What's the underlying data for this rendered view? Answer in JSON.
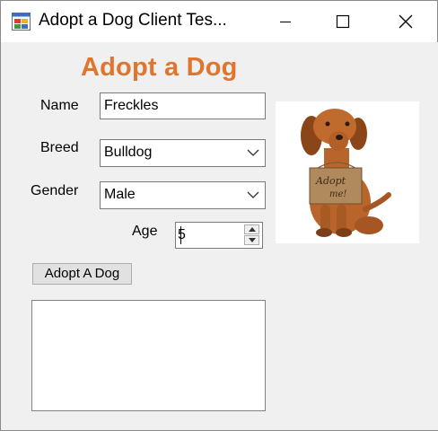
{
  "window": {
    "title": "Adopt a Dog Client Tes..."
  },
  "form": {
    "heading": "Adopt a Dog",
    "name_label": "Name",
    "name_value": "Freckles",
    "breed_label": "Breed",
    "breed_value": "Bulldog",
    "gender_label": "Gender",
    "gender_value": "Male",
    "age_label": "Age",
    "age_value": "5",
    "adopt_button_label": "Adopt A Dog",
    "photo_sign_text": "Adopt me!"
  },
  "colors": {
    "heading": "#e0752e",
    "dog_fur": "#b9642a",
    "sign": "#b08a5c"
  },
  "icons": {
    "app": "app-icon",
    "minimize": "minimize-icon",
    "maximize": "maximize-icon",
    "close": "close-icon",
    "dropdown": "chevron-down-icon",
    "spin_up": "spin-up-icon",
    "spin_down": "spin-down-icon"
  }
}
